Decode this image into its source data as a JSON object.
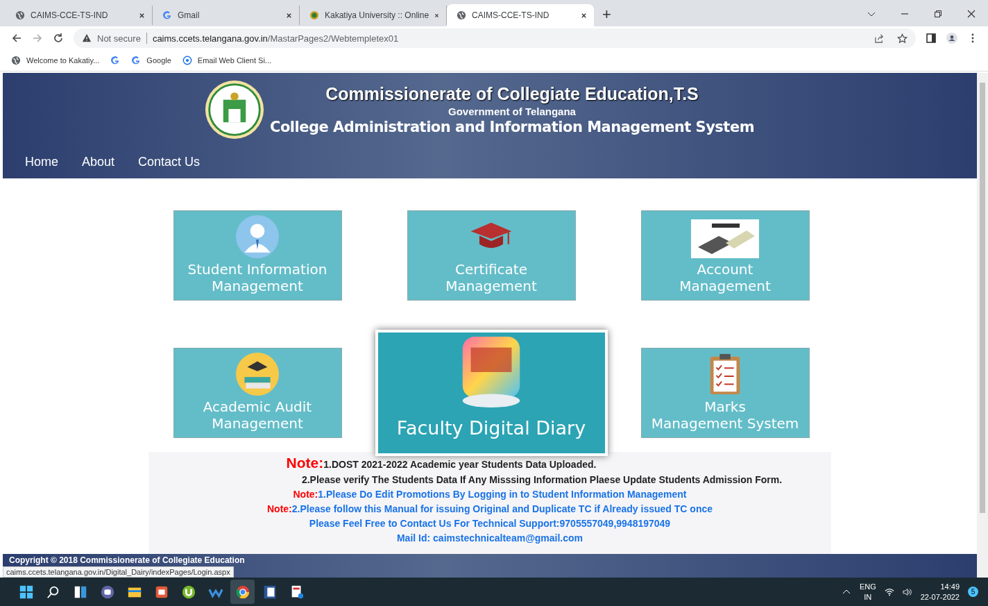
{
  "browser": {
    "tabs": [
      {
        "title": "CAIMS-CCE-TS-IND",
        "selected": false
      },
      {
        "title": "Gmail",
        "selected": false
      },
      {
        "title": "Kakatiya University :: Online",
        "selected": false
      },
      {
        "title": "CAIMS-CCE-TS-IND",
        "selected": true
      }
    ],
    "new_tab": "+",
    "security": "Not secure",
    "url_host": "caims.ccets.telangana.gov.in",
    "url_path": "/MastarPages2/Webtempletex01",
    "bookmarks": [
      {
        "label": "Welcome to Kakatiy..."
      },
      {
        "label": "Google"
      },
      {
        "label": "Email Web Client Si..."
      }
    ]
  },
  "header": {
    "title": "Commissionerate of Collegiate Education,T.S",
    "subtitle": "Government of Telangana",
    "system": "College Administration and Information Management System",
    "nav": [
      "Home",
      "About",
      "Contact Us"
    ]
  },
  "tiles": [
    {
      "lines": [
        "Student Information",
        "Management"
      ],
      "highlighted": false
    },
    {
      "lines": [
        "Certificate",
        "Management"
      ],
      "highlighted": false
    },
    {
      "lines": [
        "Account",
        "Management"
      ],
      "highlighted": false
    },
    {
      "lines": [
        "Academic Audit",
        "Management"
      ],
      "highlighted": false
    },
    {
      "lines": [
        "Faculty Digital Diary"
      ],
      "highlighted": true
    },
    {
      "lines": [
        "Marks",
        "Management System"
      ],
      "highlighted": false
    }
  ],
  "notes": {
    "main_prefix": "Note:",
    "main": [
      "1.DOST 2021-2022 Academic year Students Data Uploaded.",
      "2.Please verify The Students Data If Any Misssing Information Plaese Update Students Admission Form."
    ],
    "links": [
      {
        "prefix": "Note:",
        "text": "1.Please Do Edit Promotions By Logging in to Student Information Management"
      },
      {
        "prefix": "Note:",
        "text": "2.Please follow this Manual for issuing Original and Duplicate TC if Already issued TC once"
      },
      {
        "text": "Please Feel Free to Contact Us For Technical Support:9705557049,9948197049"
      },
      {
        "text": "Mail Id: caimstechnicalteam@gmail.com"
      }
    ]
  },
  "footer": {
    "copyright": "Copyright © 2018 Commissionerate of Collegiate Education"
  },
  "status_url": "caims.ccets.telangana.gov.in/Digital_Dairy/indexPages/Login.aspx",
  "taskbar": {
    "apps": [
      {
        "selected": false
      },
      {
        "selected": false
      },
      {
        "selected": false
      },
      {
        "selected": false
      },
      {
        "selected": false
      },
      {
        "selected": false
      },
      {
        "selected": false
      },
      {
        "selected": false
      },
      {
        "selected": true
      },
      {
        "selected": false
      },
      {
        "selected": false
      }
    ],
    "language": "ENG",
    "region": "IN",
    "time": "14:49",
    "date": "22-07-2022",
    "badge": "5"
  }
}
